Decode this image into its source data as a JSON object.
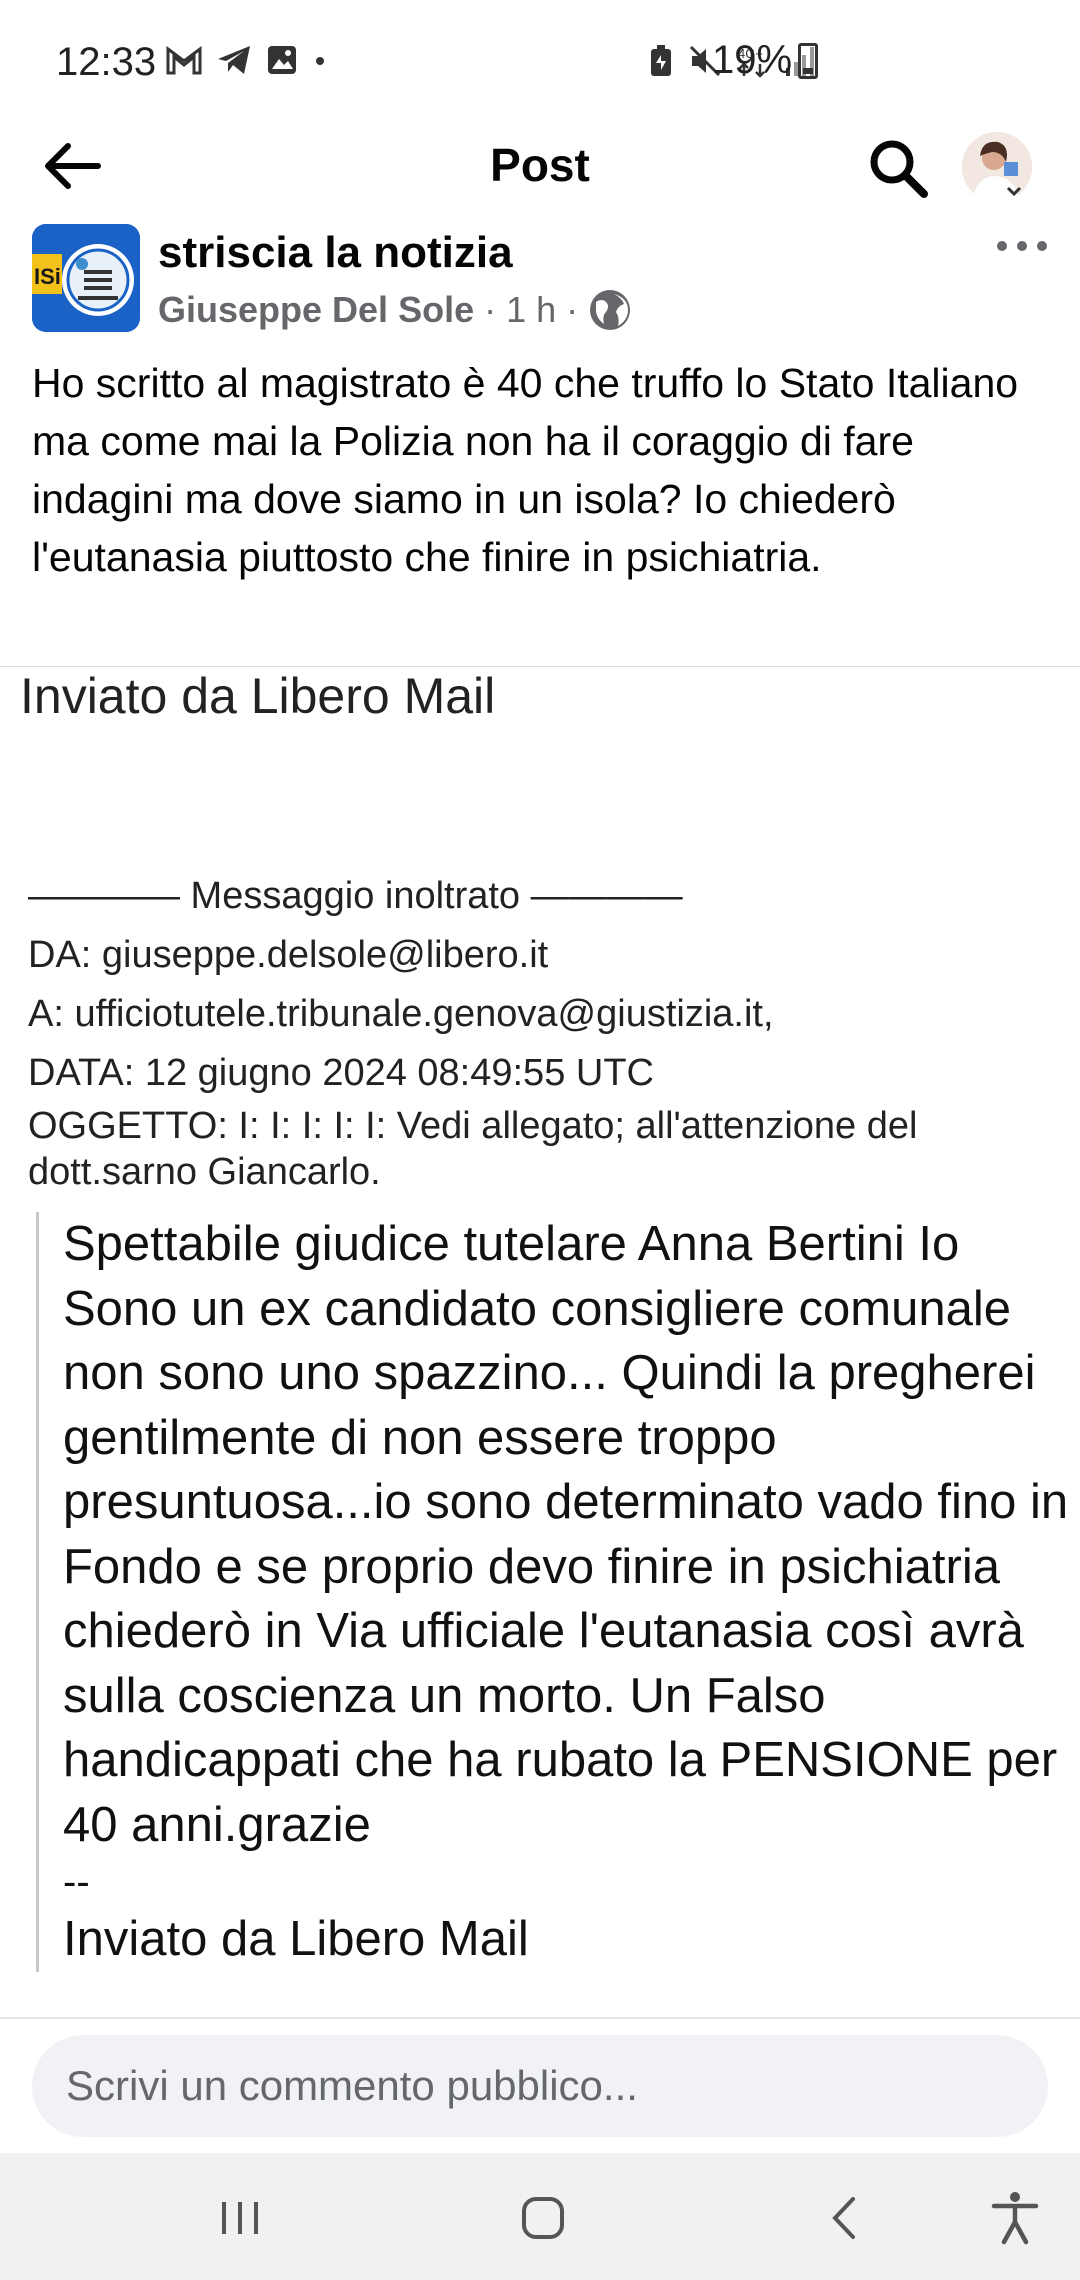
{
  "status_bar": {
    "time": "12:33",
    "left_icons": [
      "gmail-icon",
      "telegram-icon",
      "gallery-icon",
      "dot-icon"
    ],
    "right_icons": [
      "battery-saver-icon",
      "mute-icon",
      "4g-lte-icon",
      "signal-icon"
    ],
    "battery": "19%"
  },
  "header": {
    "title": "Post",
    "back_icon": "arrow-left-icon",
    "search_icon": "search-icon"
  },
  "post": {
    "page_name": "striscia la  notizia",
    "author": "Giuseppe Del Sole",
    "time": "1 h",
    "separator": "·",
    "privacy_icon": "globe-icon",
    "text": "Ho scritto al magistrato è 40 che truffo lo Stato Italiano ma come mai la Polizia non ha il coraggio di fare indagini ma dove siamo in un isola? Io chiederò l'eutanasia piuttosto che finire in psichiatria."
  },
  "image": {
    "sent_via": "Inviato da Libero Mail",
    "forward_header": "———— Messaggio inoltrato ————",
    "from": "DA: giuseppe.delsole@libero.it",
    "to": "A: ufficiotutele.tribunale.genova@giustizia.it,",
    "date": "DATA: 12 giugno 2024 08:49:55 UTC",
    "subject": "OGGETTO: I: I: I: I: I: Vedi allegato; all'attenzione del dott.sarno Giancarlo.",
    "body": "Spettabile giudice tutelare Anna Bertini Io Sono un ex candidato consigliere comunale non sono uno spazzino... Quindi la pregherei gentilmente di non essere troppo presuntuosa...io sono determinato vado fino in Fondo e se proprio devo finire in psichiatria chiederò in Via ufficiale l'eutanasia così avrà sulla coscienza un morto. Un Falso handicappati che ha rubato la PENSIONE per 40 anni.grazie",
    "signature_dash": "--",
    "signature": "Inviato da Libero Mail"
  },
  "comment": {
    "placeholder": "Scrivi un commento pubblico..."
  },
  "nav": {
    "items": [
      "recents-icon",
      "home-icon",
      "back-icon",
      "accessibility-icon"
    ]
  }
}
